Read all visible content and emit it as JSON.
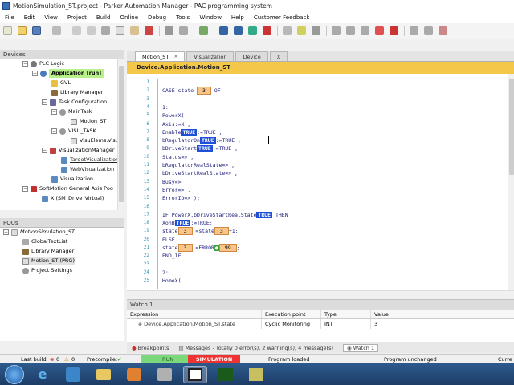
{
  "window": {
    "title": "MotionSimulation_ST.project - Parker Automation Manager - PAC programming system"
  },
  "menu": [
    "File",
    "Edit",
    "View",
    "Project",
    "Build",
    "Online",
    "Debug",
    "Tools",
    "Window",
    "Help",
    "Customer Feedback"
  ],
  "devices_panel": {
    "title": "Devices",
    "tree": [
      {
        "label": "PLC Logic",
        "icon": "plc-icon"
      },
      {
        "label": "Application [run]",
        "icon": "application-icon"
      },
      {
        "label": "GVL",
        "icon": "gvl-icon"
      },
      {
        "label": "Library Manager",
        "icon": "library-icon"
      },
      {
        "label": "Task Configuration",
        "icon": "task-config-icon"
      },
      {
        "label": "MainTask",
        "icon": "task-icon"
      },
      {
        "label": "Motion_ST",
        "icon": "pou-icon"
      },
      {
        "label": "VISU_TASK",
        "icon": "task-icon"
      },
      {
        "label": "VisuElems.Visu",
        "icon": "pou-icon"
      },
      {
        "label": "VisualizationManager",
        "icon": "visu-manager-icon"
      },
      {
        "label": "TargetVisualization",
        "icon": "visu-icon"
      },
      {
        "label": "WebVisualization",
        "icon": "visu-icon"
      },
      {
        "label": "Visualization",
        "icon": "visu-icon"
      },
      {
        "label": "SoftMotion General Axis Poo",
        "icon": "axis-pool-icon"
      },
      {
        "label": "X (SM_Drive_Virtual)",
        "icon": "axis-icon"
      }
    ]
  },
  "pous_panel": {
    "title": "POUs",
    "tree": [
      {
        "label": "MotionSimulation_ST"
      },
      {
        "label": "GlobalTextList"
      },
      {
        "label": "Library Manager"
      },
      {
        "label": "Motion_ST (PRG)"
      },
      {
        "label": "Project Settings"
      }
    ]
  },
  "tabs": [
    {
      "label": "Motion_ST",
      "active": true
    },
    {
      "label": "Visualization",
      "active": false
    },
    {
      "label": "Device",
      "active": false
    },
    {
      "label": "X",
      "active": false
    }
  ],
  "editor": {
    "path": "Device.Application.Motion_ST",
    "lines": [
      {
        "n": "1",
        "parts": []
      },
      {
        "n": "2",
        "parts": [
          {
            "t": "CASE state "
          },
          {
            "t": "3",
            "c": "mv"
          },
          {
            "t": " OF"
          }
        ]
      },
      {
        "n": "3",
        "parts": []
      },
      {
        "n": "4",
        "parts": [
          {
            "t": "1:"
          }
        ]
      },
      {
        "n": "5",
        "parts": [
          {
            "t": "PowerX("
          }
        ]
      },
      {
        "n": "6",
        "parts": [
          {
            "t": "     Axis:=X ,"
          }
        ]
      },
      {
        "n": "7",
        "parts": [
          {
            "t": "     Enable"
          },
          {
            "t": "TRUE",
            "c": "tv"
          },
          {
            "t": ":=TRUE ,"
          }
        ]
      },
      {
        "n": "8",
        "parts": [
          {
            "t": "     bRegulatorOn"
          },
          {
            "t": "TRUE",
            "c": "tv"
          },
          {
            "t": ":=TRUE ,"
          }
        ]
      },
      {
        "n": "9",
        "parts": [
          {
            "t": "     bDriveStart"
          },
          {
            "t": "TRUE",
            "c": "tv"
          },
          {
            "t": ":=TRUE ,"
          }
        ]
      },
      {
        "n": "10",
        "parts": [
          {
            "t": "     Status=> ,"
          }
        ]
      },
      {
        "n": "11",
        "parts": [
          {
            "t": "     bRegulatorRealState=> ,"
          }
        ]
      },
      {
        "n": "12",
        "parts": [
          {
            "t": "     bDriveStartRealState=> ,"
          }
        ]
      },
      {
        "n": "13",
        "parts": [
          {
            "t": "     Busy=> ,"
          }
        ]
      },
      {
        "n": "14",
        "parts": [
          {
            "t": "     Error=> ,"
          }
        ]
      },
      {
        "n": "15",
        "parts": [
          {
            "t": "     ErrorID=> );"
          }
        ]
      },
      {
        "n": "16",
        "parts": []
      },
      {
        "n": "17",
        "parts": [
          {
            "t": "     IF PowerX.bDriveStartRealState"
          },
          {
            "t": "TRUE",
            "c": "tv"
          },
          {
            "t": " THEN"
          }
        ]
      },
      {
        "n": "18",
        "parts": [
          {
            "t": "          XonB"
          },
          {
            "t": "TRUE",
            "c": "tv"
          },
          {
            "t": ":=TRUE;"
          }
        ]
      },
      {
        "n": "19",
        "parts": [
          {
            "t": "          state"
          },
          {
            "t": "3",
            "c": "mv"
          },
          {
            "t": ":=state"
          },
          {
            "t": "3",
            "c": "mv"
          },
          {
            "t": "+1;"
          }
        ]
      },
      {
        "n": "20",
        "parts": [
          {
            "t": "          ELSE"
          }
        ]
      },
      {
        "n": "21",
        "parts": [
          {
            "t": "               state"
          },
          {
            "t": "3",
            "c": "mv"
          },
          {
            "t": ":=ERROR"
          },
          {
            "t": "●",
            "c": "gv"
          },
          {
            "t": "99",
            "c": "mv"
          },
          {
            "t": ";"
          }
        ]
      },
      {
        "n": "22",
        "parts": [
          {
            "t": "     END_IF"
          }
        ]
      },
      {
        "n": "23",
        "parts": []
      },
      {
        "n": "24",
        "parts": [
          {
            "t": "2:"
          }
        ]
      },
      {
        "n": "25",
        "parts": [
          {
            "t": "HomeX("
          }
        ]
      }
    ]
  },
  "watch": {
    "title": "Watch 1",
    "columns": [
      "Expression",
      "Execution point",
      "Type",
      "Value"
    ],
    "rows": [
      {
        "expression": "Device.Application.Motion_ST.state",
        "exec_point": "Cyclic Monitoring",
        "type": "INT",
        "value": "3"
      }
    ]
  },
  "message_bar": {
    "breakpoints": "Breakpoints",
    "messages": "Messages - Totally 0 error(s), 2 warning(s), 4 message(s)",
    "watch": "Watch 1"
  },
  "status": {
    "last_build_label": "Last build:",
    "errors": "0",
    "warnings": "0",
    "precompile_label": "Precompile:",
    "run": "RUN",
    "simulation": "SIMULATION",
    "program_loaded": "Program loaded",
    "program_unchanged": "Program unchanged",
    "current_user": "Curre"
  }
}
